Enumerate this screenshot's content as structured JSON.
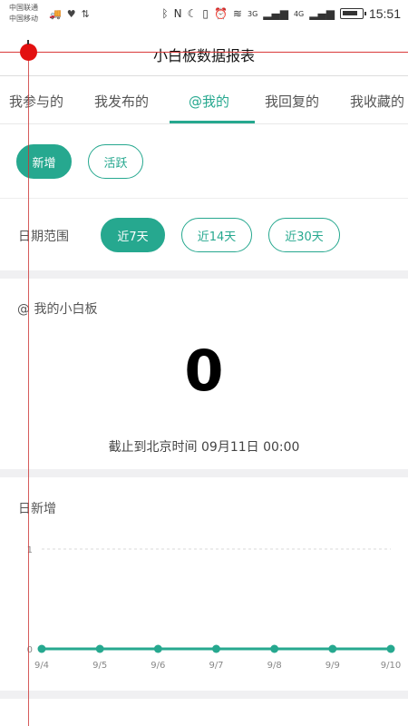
{
  "status_bar": {
    "carrier_1": "中国联通",
    "carrier_2": "中国移动",
    "time": "15:51",
    "net_1": "3G",
    "net_2": "4G",
    "battery_level": 0.85
  },
  "header": {
    "title": "小白板数据报表"
  },
  "tabs": [
    {
      "label": "我参与的"
    },
    {
      "label": "我发布的"
    },
    {
      "label": "@我的"
    },
    {
      "label": "我回复的"
    },
    {
      "label": "我收藏的"
    }
  ],
  "active_tab": "@我的",
  "metric_toggle": {
    "new": "新增",
    "active": "活跃"
  },
  "date_range": {
    "label": "日期范围",
    "options": [
      "近7天",
      "近14天",
      "近30天"
    ],
    "selected": "近7天"
  },
  "summary": {
    "title": "@ 我的小白板",
    "value": "0",
    "as_of": "截止到北京时间 09月11日 00:00"
  },
  "daily_chart": {
    "title": "日新增"
  },
  "chart_data": {
    "type": "line",
    "x": [
      "9/4",
      "9/5",
      "9/6",
      "9/7",
      "9/8",
      "9/9",
      "9/10"
    ],
    "values": [
      0,
      0,
      0,
      0,
      0,
      0,
      0
    ],
    "y_ticks": [
      "0",
      "1"
    ],
    "ylim": [
      0,
      1
    ],
    "color": "#26a88f"
  },
  "colors": {
    "accent": "#26a88f",
    "gap": "#f0f0f2"
  }
}
